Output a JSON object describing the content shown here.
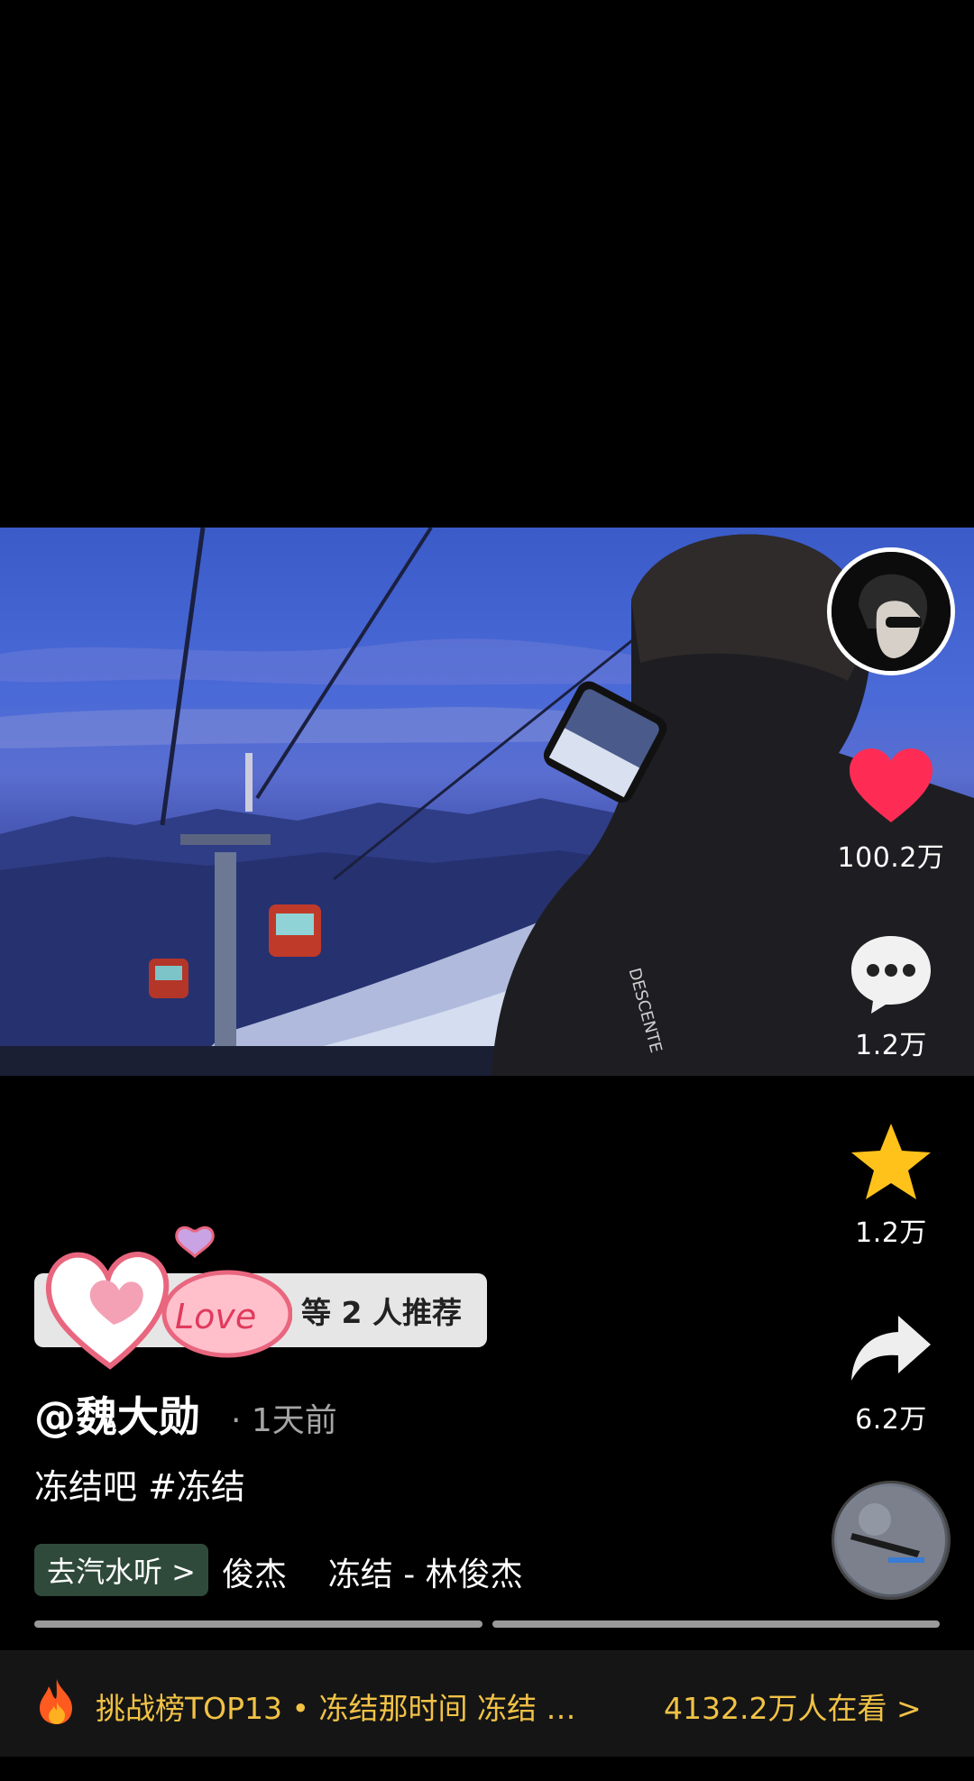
{
  "actions": {
    "like_count": "100.2万",
    "comment_count": "1.2万",
    "favorite_count": "1.2万",
    "share_count": "6.2万"
  },
  "recommend": {
    "text": "等 2 人推荐"
  },
  "author": {
    "name": "@魏大勋",
    "time": "· 1天前"
  },
  "caption": "冻结吧 #冻结",
  "music": {
    "chip_label": "去汽水听 >",
    "track_text": "俊杰    冻结 - 林俊杰"
  },
  "banner": {
    "left_text": "挑战榜TOP13 • 冻结那时间 冻结 …",
    "right_text": "4132.2万人在看 >"
  },
  "colors": {
    "like": "#fe2c55",
    "favorite": "#ffc21a",
    "banner_text": "#f1c245",
    "music_chip": "#2f4a3b"
  },
  "icons": [
    "heart-icon",
    "comment-icon",
    "star-icon",
    "share-icon",
    "fire-icon",
    "love-sticker"
  ]
}
